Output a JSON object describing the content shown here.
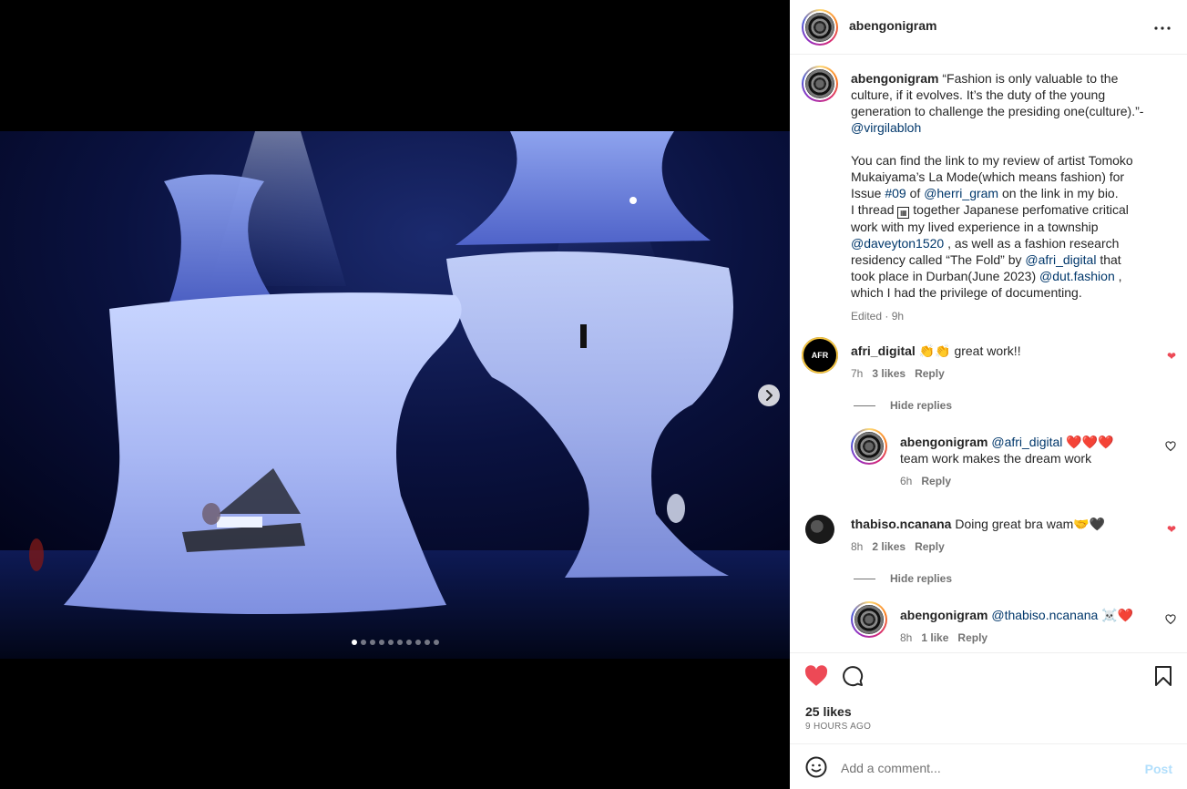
{
  "post": {
    "username": "abengonigram",
    "more_icon": "more-horizontal-icon",
    "carousel": {
      "total_slides": 10,
      "active_slide": 1
    },
    "caption": {
      "username": "abengonigram",
      "line1": "“Fashion is only valuable to the",
      "line2": "culture, if it evolves. It’s the duty of the young",
      "line3": "generation to challenge the presiding one(culture).”-",
      "mention1": "@virgilabloh",
      "p2_line1": "You can find the link to my review of artist Tomoko",
      "p2_line2": "Mukaiyama’s La Mode(which means fashion) for",
      "p2_line3a": "Issue",
      "p2_hashtag": "#09",
      "p2_line3b": "of",
      "p2_mention": "@herri_gram",
      "p2_line3c": "on the link in my bio.",
      "p2_line4a": "I thread",
      "p2_line4b": "together Japanese perfomative critical",
      "p2_line5": "work with my lived experience in a township",
      "p2_mention2": "@daveyton1520",
      "p2_line6b": ", as well as a fashion research",
      "p2_line7a": "residency called “The Fold” by",
      "p2_mention3": "@afri_digital",
      "p2_line7b": "that",
      "p2_line8a": "took place in Durban(June 2023)",
      "p2_mention4": "@dut.fashion",
      "p2_line8b": ",",
      "p2_line9": "which I had the privilege of documenting.",
      "edited": "Edited · 9h"
    },
    "comments": [
      {
        "username": "afri_digital",
        "text": "👏👏 great work!!",
        "time": "7h",
        "likes": "3 likes",
        "reply": "Reply",
        "liked": true,
        "hide_replies": "Hide replies",
        "replies": [
          {
            "username": "abengonigram",
            "mention": "@afri_digital",
            "text": "❤️❤️❤️",
            "text2": "team work makes the dream work",
            "time": "6h",
            "reply": "Reply"
          }
        ]
      },
      {
        "username": "thabiso.ncanana",
        "text": "Doing great bra wam🤝🖤",
        "time": "8h",
        "likes": "2 likes",
        "reply": "Reply",
        "liked": true,
        "hide_replies": "Hide replies",
        "replies": [
          {
            "username": "abengonigram",
            "mention": "@thabiso.ncanana",
            "text": "☠️❤️",
            "time": "8h",
            "likes": "1 like",
            "reply": "Reply"
          }
        ]
      }
    ],
    "likes": "25 likes",
    "time_ago": "9 HOURS AGO",
    "add_comment": {
      "placeholder": "Add a comment...",
      "post_label": "Post"
    },
    "colors": {
      "like_red": "#ed4956",
      "link_blue": "#00376b",
      "post_disabled": "#b2dffc"
    }
  }
}
